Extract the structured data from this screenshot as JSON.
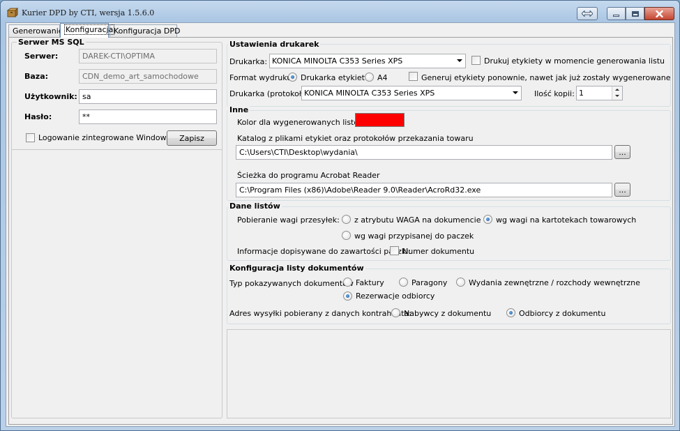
{
  "window": {
    "title": "Kurier DPD by CTI, wersja 1.5.6.0",
    "icon": "dpd-courier-icon"
  },
  "tabs": [
    "Generowanie",
    "Konfiguracja",
    "Konfiguracja DPD"
  ],
  "sql": {
    "group_title": "Serwer MS SQL",
    "server_label": "Serwer:",
    "server_value": "DAREK-CTI\\OPTIMA",
    "db_label": "Baza:",
    "db_value": "CDN_demo_art_samochodowe",
    "user_label": "Użytkownik:",
    "user_value": "sa",
    "password_label": "Hasło:",
    "password_value": "**",
    "windows_auth_label": "Logowanie zintegrowane Windows",
    "save_label": "Zapisz"
  },
  "printers": {
    "group_title": "Ustawienia drukarek",
    "printer_label": "Drukarka:",
    "printer_value": "KONICA MINOLTA C353 Series XPS",
    "print_on_generate_label": "Drukuj etykiety w momencie generowania listu",
    "format_label": "Format wydruku:",
    "format_label_printer": "Drukarka etykiet",
    "format_a4": "A4",
    "regenerate_label": "Generuj etykiety ponownie, nawet jak już zostały wygenerowane",
    "protocol_printer_label": "Drukarka (protokoły):",
    "protocol_printer_value": "KONICA MINOLTA C353 Series XPS",
    "copies_label": "Ilość kopii:",
    "copies_value": "1"
  },
  "other": {
    "group_title": "Inne",
    "color_label": "Kolor dla wygenerowanych listów:",
    "color_value": "#ff0000",
    "catalog_label": "Katalog z plikami etykiet oraz protokołów przekazania towaru",
    "catalog_value": "C:\\Users\\CTI\\Desktop\\wydania\\",
    "browse_label": "...",
    "acrobat_label": "Ścieżka do programu Acrobat Reader",
    "acrobat_value": "C:\\Program Files (x86)\\Adobe\\Reader 9.0\\Reader\\AcroRd32.exe"
  },
  "letters": {
    "group_title": "Dane listów",
    "weight_label": "Pobieranie wagi przesyłek:",
    "weight_opt1": "z atrybutu WAGA na dokumencie",
    "weight_opt2": "wg wagi na kartotekach towarowych",
    "weight_opt3": "wg wagi przypisanej do paczek",
    "info_label": "Informacje dopisywane do zawartości paczki:",
    "doc_number_label": "Numer dokumentu"
  },
  "doclist": {
    "group_title": "Konfiguracja listy dokumentów",
    "type_label": "Typ pokazywanych dokumentów",
    "type_invoices": "Faktury",
    "type_receipts": "Paragony",
    "type_releases": "Wydania zewnętrzne / rozchody wewnętrzne",
    "type_reservations": "Rezerwacje odbiorcy",
    "address_label": "Adres wysyłki pobierany z danych kontrahenta:",
    "address_buyers": "Nabywcy z dokumentu",
    "address_recipients": "Odbiorcy z dokumentu"
  }
}
